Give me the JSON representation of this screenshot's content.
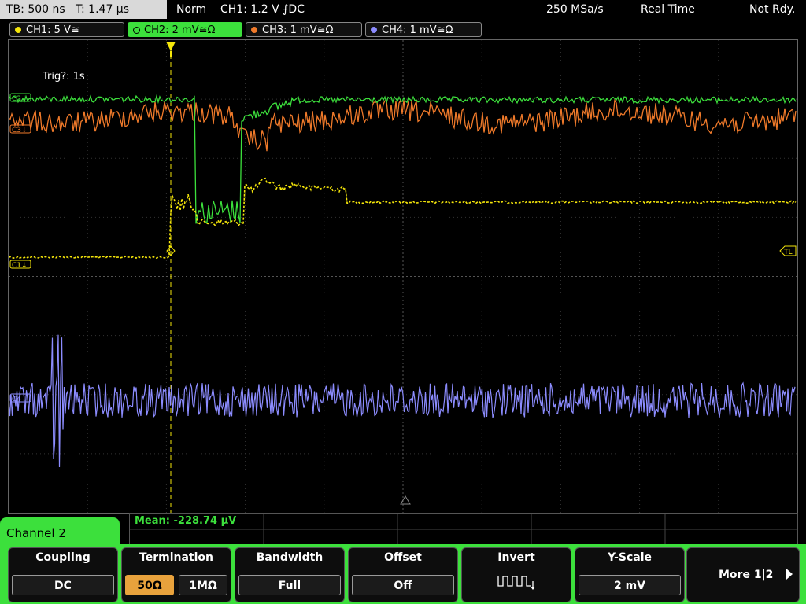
{
  "header": {
    "timebase": "TB: 500 ns",
    "trigger_time": "T: 1.47 µs",
    "mode": "Norm",
    "trigger_info": "CH1: 1.2 V ⨍DC",
    "sample_rate": "250 MSa/s",
    "acq_mode": "Real Time",
    "status": "Not Rdy."
  },
  "channels": [
    {
      "label": "CH1: 5 V≅",
      "color": "#f5e60a",
      "active": false
    },
    {
      "label": "CH2: 2 mV≅Ω",
      "color": "#3ce03c",
      "active": true
    },
    {
      "label": "CH3: 1 mV≅Ω",
      "color": "#f07a2a",
      "active": false
    },
    {
      "label": "CH4: 1 mV≅Ω",
      "color": "#8c8cff",
      "active": false
    }
  ],
  "display": {
    "trig_status": "Trig?: 1s",
    "markers": {
      "ch1": "C1↓",
      "ch2": "C2↓",
      "ch3": "C3↓",
      "ch4": "C4↓",
      "trigger_level": "TL",
      "trigger_pos": "T"
    },
    "measurement": "Mean: -228.74 µV"
  },
  "menu": {
    "title": "Channel 2",
    "coupling": {
      "label": "Coupling",
      "value": "DC"
    },
    "termination": {
      "label": "Termination",
      "option_a": "50Ω",
      "option_b": "1MΩ",
      "selected": "50Ω"
    },
    "bandwidth": {
      "label": "Bandwidth",
      "value": "Full"
    },
    "offset": {
      "label": "Offset",
      "value": "Off"
    },
    "invert": {
      "label": "Invert",
      "icon": "invert-square-wave-icon"
    },
    "yscale": {
      "label": "Y-Scale",
      "value": "2 mV"
    },
    "more": {
      "label": "More 1|2"
    }
  }
}
